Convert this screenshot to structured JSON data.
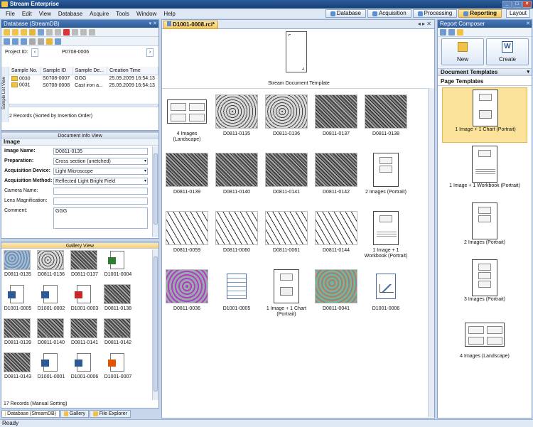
{
  "app": {
    "title": "Stream Enterprise"
  },
  "menu": [
    "File",
    "Edit",
    "View",
    "Database",
    "Acquire",
    "Tools",
    "Window",
    "Help"
  ],
  "modules": {
    "tabs": [
      "Database",
      "Acquisition",
      "Processing",
      "Reporting"
    ],
    "active": "Reporting",
    "layout_label": "Layout"
  },
  "db_panel": {
    "title": "Database (StreamDB)",
    "project_label": "Project ID:",
    "project_value": "P0708-0006",
    "side_label": "Sample List View",
    "columns": [
      "Sample No.",
      "Sample ID",
      "Sample De...",
      "Creation Time"
    ],
    "rows": [
      {
        "no": "0030",
        "id": "S0708-0007",
        "desc": "GGG",
        "time": "25.09.2009 16:54:13"
      },
      {
        "no": "0031",
        "id": "S0708-0008",
        "desc": "Cast iron a...",
        "time": "25.09.2009 16:54:13"
      }
    ],
    "records": "2 Records (Sorted by Insertion Order)"
  },
  "doc_info": {
    "header": "Document Info View",
    "section": "Image",
    "fields": [
      {
        "label": "Image Name:",
        "value": "D0811-0135",
        "bold": true
      },
      {
        "label": "Preparation:",
        "value": "Cross section (unetched)",
        "bold": true,
        "select": true
      },
      {
        "label": "Acquisition Device:",
        "value": "Light Microscope",
        "bold": true,
        "select": true
      },
      {
        "label": "Acquisition Method:",
        "value": "Reflected Light Bright Field",
        "bold": true,
        "select": true
      },
      {
        "label": "Camera Name:",
        "value": "",
        "bold": false
      },
      {
        "label": "Lens Magnification:",
        "value": "",
        "bold": false
      },
      {
        "label": "Comment:",
        "value": "GGG",
        "bold": false
      }
    ]
  },
  "gallery": {
    "header": "Gallery View",
    "items": [
      {
        "label": "D0811-0135",
        "kind": "blue"
      },
      {
        "label": "D0811-0136",
        "kind": "light"
      },
      {
        "label": "D0811-0137",
        "kind": "dark"
      },
      {
        "label": "D1001-0004",
        "kind": "excel"
      },
      {
        "label": "D1001-0005",
        "kind": "word"
      },
      {
        "label": "D1001-0002",
        "kind": "word"
      },
      {
        "label": "D1001-0003",
        "kind": "pdf"
      },
      {
        "label": "D0811-0138",
        "kind": "dark"
      },
      {
        "label": "D0811-0139",
        "kind": "dark"
      },
      {
        "label": "D0811-0140",
        "kind": "dark"
      },
      {
        "label": "D0811-0141",
        "kind": "dark"
      },
      {
        "label": "D0811-0142",
        "kind": "dark"
      },
      {
        "label": "D0811-0143",
        "kind": "dark"
      },
      {
        "label": "D1001-0001",
        "kind": "report"
      },
      {
        "label": "D1001-0006",
        "kind": "chart"
      },
      {
        "label": "D1001-0007",
        "kind": "ppt"
      }
    ],
    "records": "17 Records (Manual Sorting)"
  },
  "bottom_tabs": [
    "Database (StreamDB)",
    "Gallery",
    "File Explorer"
  ],
  "status": "Ready",
  "document": {
    "tab_label": "D1001-0008.rci*",
    "template_label": "Stream Document Template",
    "items": [
      {
        "label": "4 Images (Landscape)",
        "kind": "tmpl4land"
      },
      {
        "label": "D0811-0135",
        "kind": "light"
      },
      {
        "label": "D0811-0136",
        "kind": "light"
      },
      {
        "label": "D0811-0137",
        "kind": "dark"
      },
      {
        "label": "D0811-0138",
        "kind": "dark"
      },
      {
        "label": "D0811-0139",
        "kind": "dark"
      },
      {
        "label": "D0811-0140",
        "kind": "dark"
      },
      {
        "label": "D0811-0141",
        "kind": "dark"
      },
      {
        "label": "D0811-0142",
        "kind": "dark"
      },
      {
        "label": "2 Images (Portrait)",
        "kind": "tmpl2"
      },
      {
        "label": "D0811-0059",
        "kind": "white"
      },
      {
        "label": "D0811-0060",
        "kind": "white"
      },
      {
        "label": "D0811-0061",
        "kind": "white"
      },
      {
        "label": "D0811-0144",
        "kind": "white"
      },
      {
        "label": "1 Image + 1 Workbook (Portrait)",
        "kind": "tmplwb"
      },
      {
        "label": "D0811-0036",
        "kind": "pink"
      },
      {
        "label": "D1001-0005",
        "kind": "sheet"
      },
      {
        "label": "1 Image + 1 Chart (Portrait)",
        "kind": "tmplchart"
      },
      {
        "label": "D0811-0041",
        "kind": "color"
      },
      {
        "label": "D1001-0006",
        "kind": "chartdoc"
      }
    ]
  },
  "composer": {
    "title": "Report Composer",
    "new_label": "New",
    "create_label": "Create",
    "doc_templates": "Document Templates",
    "page_templates": "Page Templates",
    "templates": [
      {
        "label": "1 Image + 1 Chart (Portrait)",
        "kind": "tmplchart",
        "selected": true
      },
      {
        "label": "1 Image + 1 Workbook (Portrait)",
        "kind": "tmplwb",
        "selected": false
      },
      {
        "label": "2 Images (Portrait)",
        "kind": "tmpl2",
        "selected": false
      },
      {
        "label": "3 Images (Portrait)",
        "kind": "tmpl3",
        "selected": false
      },
      {
        "label": "4 Images (Landscape)",
        "kind": "tmpl4land",
        "selected": false
      }
    ]
  }
}
